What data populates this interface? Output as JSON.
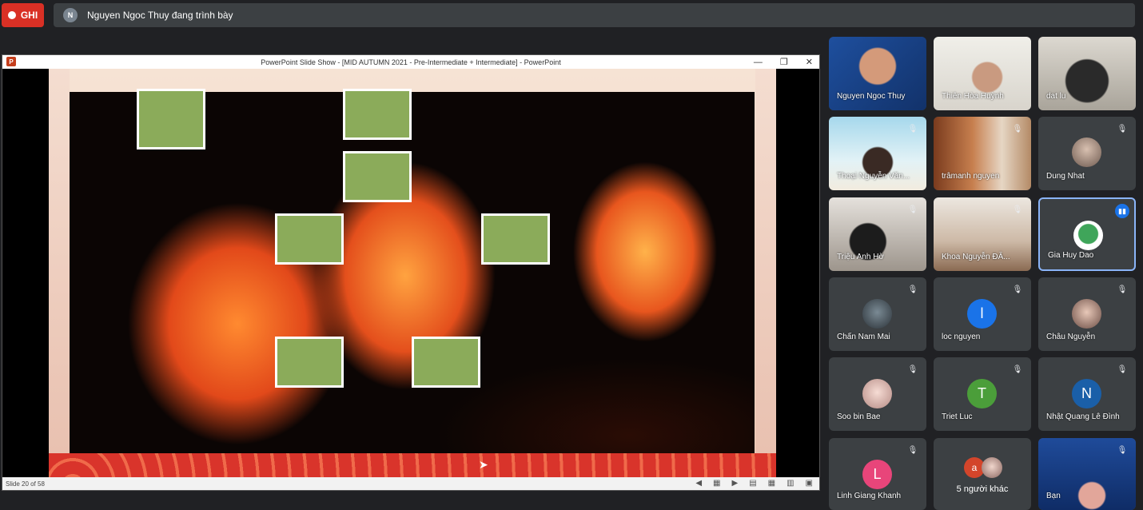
{
  "record": {
    "label": "GHI"
  },
  "presenter": {
    "initial": "N",
    "text": "Nguyen Ngoc Thuy đang trình bày"
  },
  "ppt": {
    "logo": "P",
    "title": "PowerPoint Slide Show - [MID AUTUMN 2021 - Pre-Intermediate + Intermediate] - PowerPoint",
    "minimize": "—",
    "restore": "❐",
    "close": "✕",
    "status": "Slide 20 of 58",
    "status_icons": [
      "◀",
      "▦",
      "▶",
      "▤",
      "▦",
      "▥",
      "▣"
    ]
  },
  "participants": [
    {
      "name": "Nguyen Ngoc Thuy",
      "type": "video",
      "muted": false
    },
    {
      "name": "Thiên Hòa Huỳnh",
      "type": "video",
      "muted": false
    },
    {
      "name": "dat lu",
      "type": "video",
      "muted": false
    },
    {
      "name": "Thoại Nguyễn Văn...",
      "type": "video",
      "muted": true
    },
    {
      "name": "trâmanh nguyen",
      "type": "video",
      "muted": true
    },
    {
      "name": "Dung Nhat",
      "type": "avatar-photo",
      "muted": true
    },
    {
      "name": "Triệu Anh Hờ",
      "type": "video",
      "muted": true
    },
    {
      "name": "Khoa Nguyễn ĐĂ...",
      "type": "video",
      "muted": true
    },
    {
      "name": "Gia Huy Dao",
      "type": "avatar-photo",
      "muted": false,
      "speaking": true
    },
    {
      "name": "Chấn Nam Mai",
      "type": "avatar-photo",
      "muted": true
    },
    {
      "name": "loc nguyen",
      "type": "avatar-letter",
      "letter": "l",
      "color": "#1a73e8",
      "muted": true
    },
    {
      "name": "Châu Nguyễn",
      "type": "avatar-photo",
      "muted": true
    },
    {
      "name": "Soo bin Bae",
      "type": "avatar-photo",
      "muted": true
    },
    {
      "name": "Triet Luc",
      "type": "avatar-letter",
      "letter": "T",
      "color": "#4b9e3a",
      "muted": true
    },
    {
      "name": "Nhật Quang Lê Đình",
      "type": "avatar-letter",
      "letter": "N",
      "color": "#1a5fa8",
      "muted": true
    },
    {
      "name": "Linh Giang Khanh",
      "type": "avatar-letter",
      "letter": "L",
      "color": "#e8457a",
      "muted": true
    },
    {
      "name": "5 người khác",
      "type": "others",
      "letter": "a",
      "color": "#d3452b",
      "muted": false
    },
    {
      "name": "Bạn",
      "type": "video",
      "muted": true
    }
  ],
  "icons": {
    "mute": "mic-off-icon",
    "speaking": "audio-level-icon",
    "cursor": "mouse-pointer-icon"
  }
}
